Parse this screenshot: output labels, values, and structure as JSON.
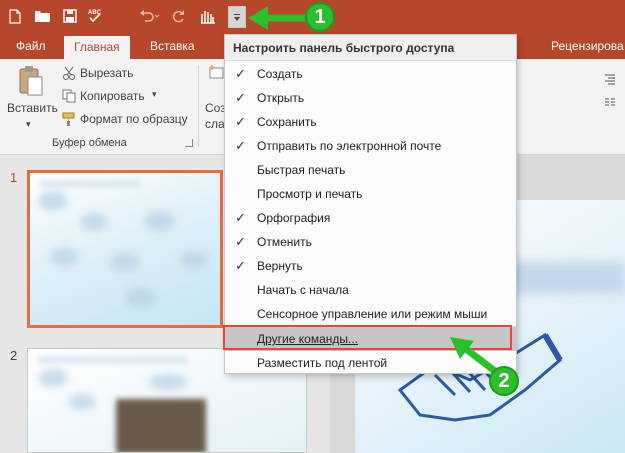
{
  "ribbon": {
    "tabs": [
      "Файл",
      "Главная",
      "Вставка",
      "Рецензирова"
    ],
    "paste_label": "Вставить",
    "cut_label": "Вырезать",
    "copy_label": "Копировать",
    "format_painter_label": "Формат по образцу",
    "clipboard_group": "Буфер обмена",
    "create_partial": "Созд",
    "slide_partial": "сла"
  },
  "slides": {
    "numbers": [
      "1",
      "2"
    ]
  },
  "menu": {
    "title": "Настроить панель быстрого доступа",
    "items": [
      {
        "label": "Создать",
        "checked": true
      },
      {
        "label": "Открыть",
        "checked": true
      },
      {
        "label": "Сохранить",
        "checked": true
      },
      {
        "label": "Отправить по электронной почте",
        "checked": true
      },
      {
        "label": "Быстрая печать",
        "checked": false
      },
      {
        "label": "Просмотр и печать",
        "checked": false
      },
      {
        "label": "Орфография",
        "checked": true
      },
      {
        "label": "Отменить",
        "checked": true
      },
      {
        "label": "Вернуть",
        "checked": true
      },
      {
        "label": "Начать с начала",
        "checked": false
      },
      {
        "label": "Сенсорное управление или режим мыши",
        "checked": false
      }
    ],
    "more_commands": "Другие команды...",
    "below_ribbon": "Разместить под лентой",
    "check_glyph": "✓"
  },
  "annotations": {
    "step1": "1",
    "step2": "2"
  },
  "colors": {
    "accent": "#b7472a",
    "annotation_green": "#2bbf2b",
    "highlight_box": "#e8463c"
  }
}
